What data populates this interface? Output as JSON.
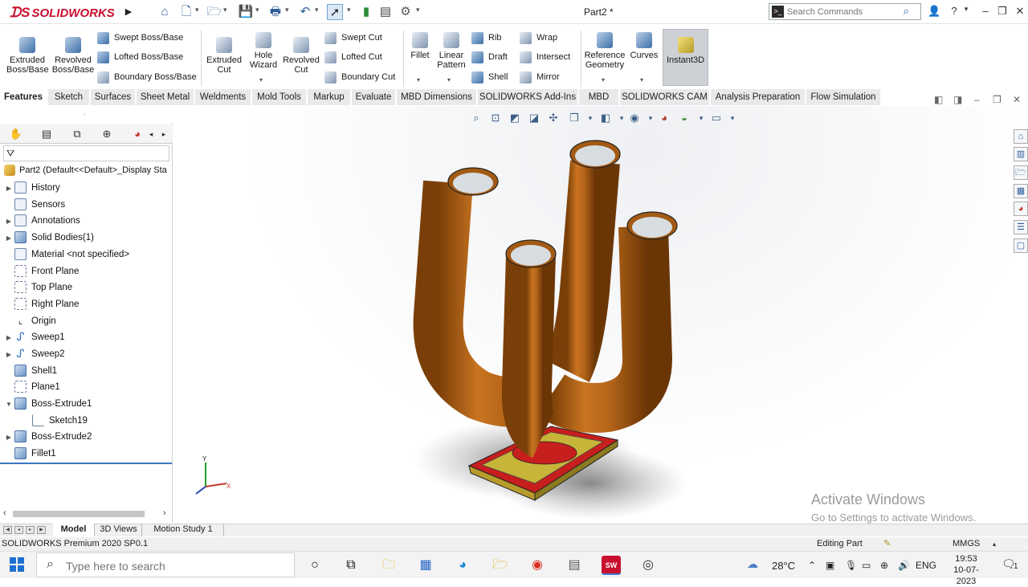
{
  "app": {
    "logo_text": "SOLIDWORKS",
    "doc_title": "Part2 *"
  },
  "search": {
    "placeholder": "Search Commands"
  },
  "ribbon": {
    "extruded_boss": "Extruded Boss/Base",
    "revolved_boss": "Revolved Boss/Base",
    "swept_boss": "Swept Boss/Base",
    "lofted_boss": "Lofted Boss/Base",
    "boundary_boss": "Boundary Boss/Base",
    "extruded_cut": "Extruded Cut",
    "hole_wizard": "Hole Wizard",
    "revolved_cut": "Revolved Cut",
    "swept_cut": "Swept Cut",
    "lofted_cut": "Lofted Cut",
    "boundary_cut": "Boundary Cut",
    "fillet": "Fillet",
    "linear_pattern": "Linear Pattern",
    "rib": "Rib",
    "draft": "Draft",
    "shell": "Shell",
    "wrap": "Wrap",
    "intersect": "Intersect",
    "mirror": "Mirror",
    "reference_geometry": "Reference Geometry",
    "curves": "Curves",
    "instant3d": "Instant3D"
  },
  "tabs": [
    "Features",
    "Sketch",
    "Surfaces",
    "Sheet Metal",
    "Weldments",
    "Mold Tools",
    "Markup",
    "Evaluate",
    "MBD Dimensions",
    "SOLIDWORKS Add-Ins",
    "MBD",
    "SOLIDWORKS CAM",
    "Analysis Preparation",
    "Flow Simulation"
  ],
  "tree": {
    "root": "Part2  (Default<<Default>_Display Sta",
    "items": [
      "History",
      "Sensors",
      "Annotations",
      "Solid Bodies(1)",
      "Material <not specified>",
      "Front Plane",
      "Top Plane",
      "Right Plane",
      "Origin",
      "Sweep1",
      "Sweep2",
      "Shell1",
      "Plane1",
      "Boss-Extrude1",
      "Sketch19",
      "Boss-Extrude2",
      "Fillet1"
    ]
  },
  "triad": {
    "x": "X",
    "y": "Y"
  },
  "watermark": {
    "line1": "Activate Windows",
    "line2": "Go to Settings to activate Windows."
  },
  "bottom_tabs": [
    "Model",
    "3D Views",
    "Motion Study 1"
  ],
  "status": {
    "left": "SOLIDWORKS Premium 2020 SP0.1",
    "mode": "Editing Part",
    "units": "MMGS"
  },
  "taskbar": {
    "search_placeholder": "Type here to search",
    "temperature": "28°C",
    "language": "ENG",
    "time": "19:53",
    "date": "10-07-2023",
    "notifications": "1"
  }
}
